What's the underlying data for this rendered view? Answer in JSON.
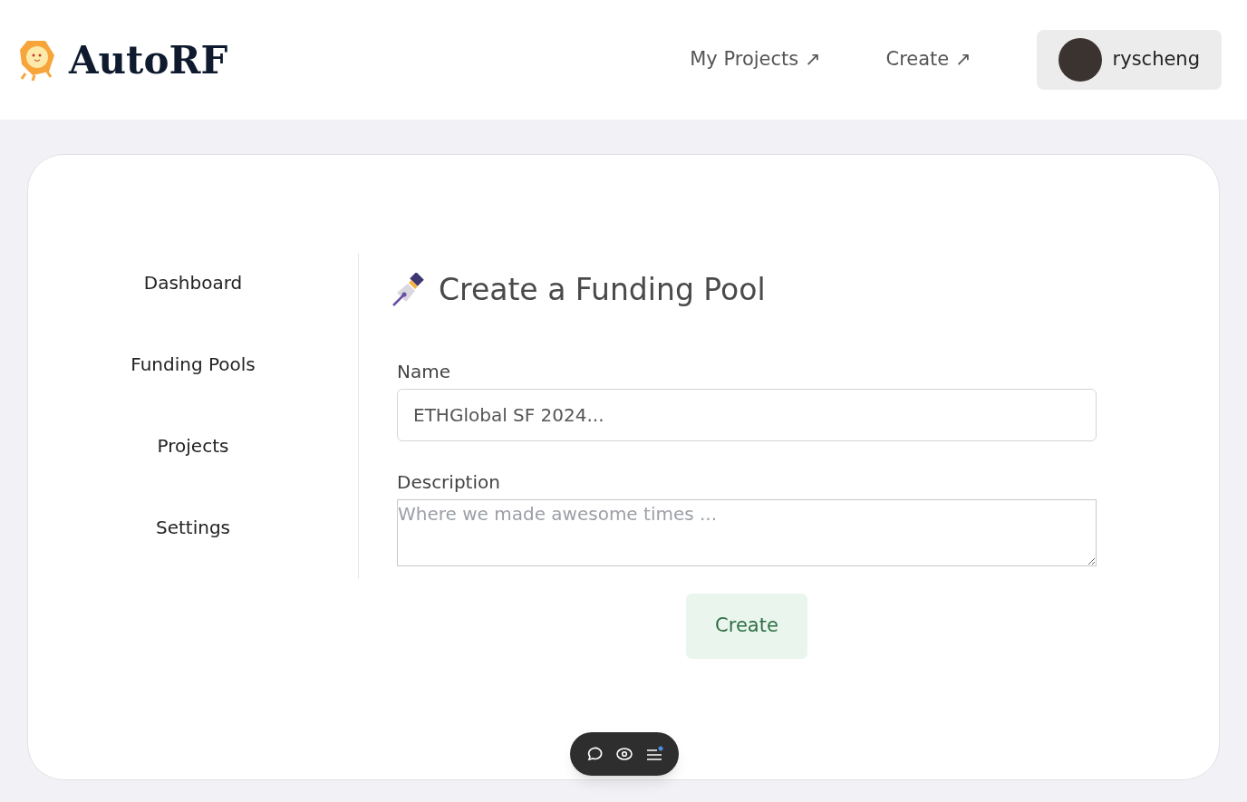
{
  "header": {
    "logo_text": "AutoRF",
    "nav": [
      {
        "label": "My Projects",
        "icon": "↗"
      },
      {
        "label": "Create",
        "icon": "↗"
      }
    ],
    "user": {
      "name": "ryscheng"
    }
  },
  "sidebar": {
    "items": [
      {
        "label": "Dashboard"
      },
      {
        "label": "Funding Pools"
      },
      {
        "label": "Projects"
      },
      {
        "label": "Settings"
      }
    ]
  },
  "form": {
    "title": "Create a Funding Pool",
    "fields": [
      {
        "kind": "input",
        "label": "Name",
        "value": "ETHGlobal SF 2024..."
      },
      {
        "kind": "textarea",
        "label": "Description",
        "placeholder": "Where we made awesome times ..."
      }
    ],
    "submit": "Create"
  }
}
